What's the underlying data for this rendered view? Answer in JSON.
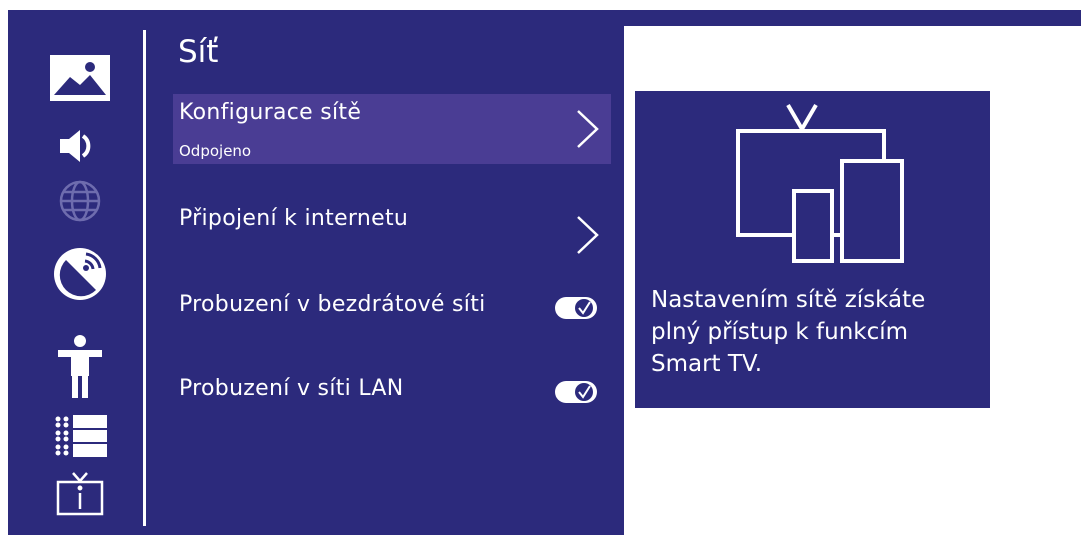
{
  "title": "Síť",
  "sidebar": {
    "items": [
      {
        "icon": "picture-icon",
        "active": true
      },
      {
        "icon": "sound-icon",
        "active": true
      },
      {
        "icon": "globe-icon",
        "active": false
      },
      {
        "icon": "satellite-dish-icon",
        "active": true
      },
      {
        "icon": "accessibility-icon",
        "active": true
      },
      {
        "icon": "list-settings-icon",
        "active": true
      },
      {
        "icon": "tv-info-icon",
        "active": true
      }
    ]
  },
  "menu": {
    "items": [
      {
        "label": "Konfigurace sítě",
        "sub": "Odpojeno",
        "type": "submenu",
        "selected": true
      },
      {
        "label": "Připojení k internetu",
        "type": "submenu",
        "selected": false
      },
      {
        "label": "Probuzení v bezdrátové síti",
        "type": "toggle",
        "on": true
      },
      {
        "label": "Probuzení v síti LAN",
        "type": "toggle",
        "on": true
      }
    ]
  },
  "info": {
    "text": "Nastavením sítě získáte plný přístup k funkcím Smart TV.",
    "icon": "tv-multiscreen-icon"
  },
  "colors": {
    "background": "#2c2a7c",
    "selected_row": "#4a3d94",
    "foreground": "#ffffff",
    "disabled_icon": "#6e6cae"
  }
}
